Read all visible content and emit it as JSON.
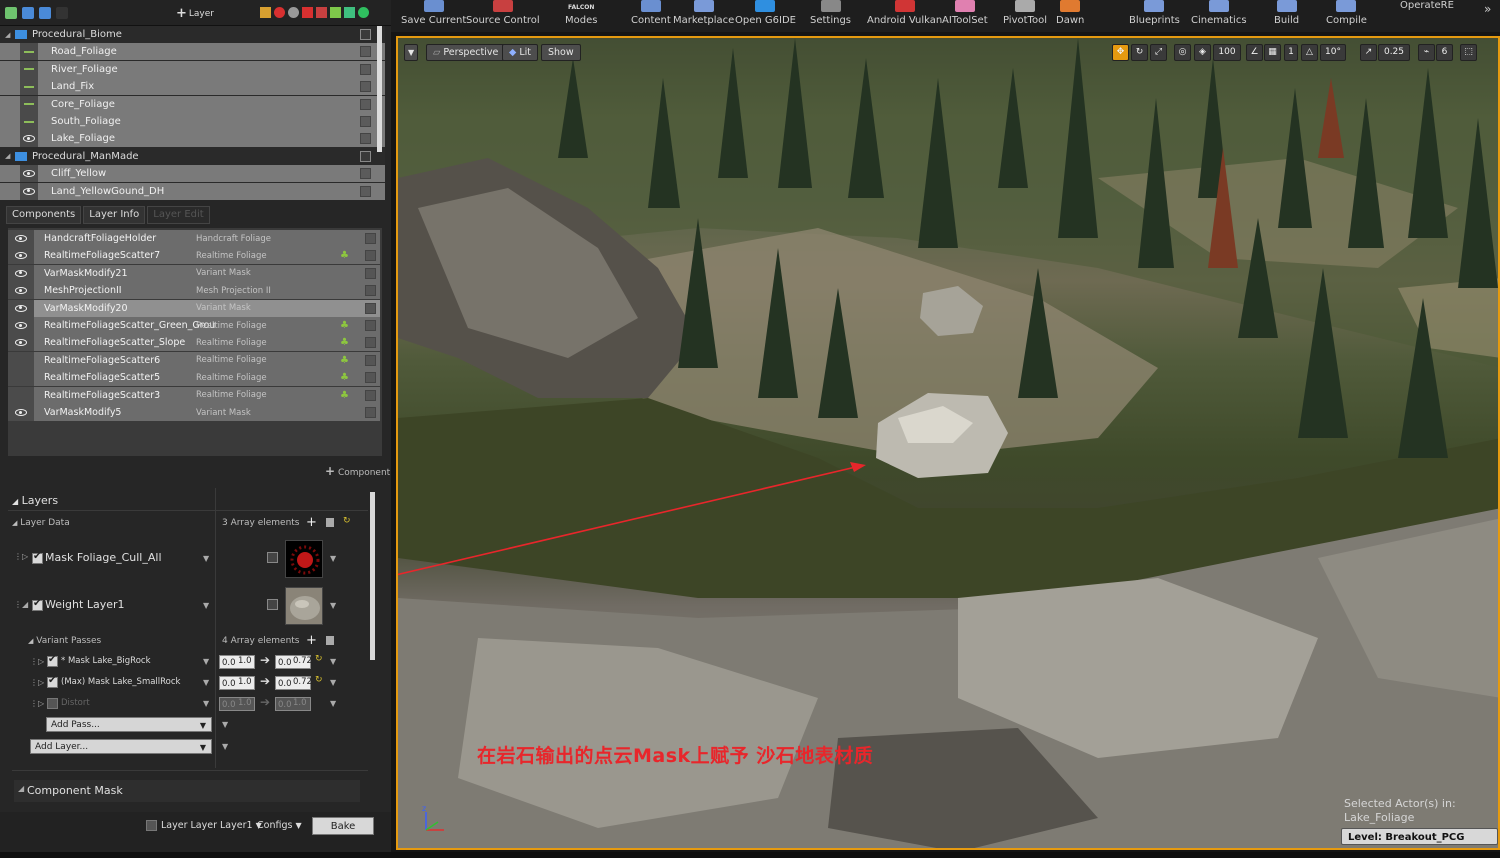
{
  "outliner": {
    "toolbar_layer_label": "Layer",
    "rows": [
      {
        "label": "Procedural_Biome",
        "type": "folder"
      },
      {
        "label": "Road_Foliage",
        "type": "child",
        "visible": false
      },
      {
        "label": "River_Foliage",
        "type": "child",
        "visible": false
      },
      {
        "label": "Land_Fix",
        "type": "child",
        "visible": false
      },
      {
        "label": "Core_Foliage",
        "type": "child",
        "visible": false
      },
      {
        "label": "South_Foliage",
        "type": "child",
        "visible": false
      },
      {
        "label": "Lake_Foliage",
        "type": "child",
        "visible": true
      },
      {
        "label": "Procedural_ManMade",
        "type": "folder"
      },
      {
        "label": "Cliff_Yellow",
        "type": "child",
        "visible": true
      },
      {
        "label": "Land_YellowGound_DH",
        "type": "child",
        "visible": true
      }
    ]
  },
  "tabs": [
    "Components",
    "Layer Info",
    "Layer Edit"
  ],
  "components": [
    {
      "name": "HandcraftFoliageHolder",
      "type": "Handcraft Foliage"
    },
    {
      "name": "RealtimeFoliageScatter7",
      "type": "Realtime Foliage"
    },
    {
      "name": "VarMaskModify21",
      "type": "Variant Mask"
    },
    {
      "name": "MeshProjectionII",
      "type": "Mesh Projection II"
    },
    {
      "name": "VarMaskModify20",
      "type": "Variant Mask"
    },
    {
      "name": "RealtimeFoliageScatter_Green_Grou",
      "type": "Realtime Foliage"
    },
    {
      "name": "RealtimeFoliageScatter_Slope",
      "type": "Realtime Foliage"
    },
    {
      "name": "RealtimeFoliageScatter6",
      "type": "Realtime Foliage"
    },
    {
      "name": "RealtimeFoliageScatter5",
      "type": "Realtime Foliage"
    },
    {
      "name": "RealtimeFoliageScatter3",
      "type": "Realtime Foliage"
    },
    {
      "name": "VarMaskModify5",
      "type": "Variant Mask"
    }
  ],
  "add_component_label": "Component",
  "layers": {
    "title": "Layers",
    "layer_data_label": "Layer Data",
    "layer_data_count": "3 Array elements",
    "mask_layer": "Mask Foliage_Cull_All",
    "weight_layer": "Weight Layer1",
    "variant_passes_label": "Variant Passes",
    "variant_passes_count": "4 Array elements",
    "passes": [
      {
        "label": "* Mask Lake_BigRock",
        "a": "0.0",
        "b": "1.0",
        "c": "0.0",
        "d": "0.72"
      },
      {
        "label": "(Max) Mask Lake_SmallRock",
        "a": "0.0",
        "b": "1.0",
        "c": "0.0",
        "d": "0.72"
      },
      {
        "label": "Distort",
        "a": "0.0",
        "b": "1.0",
        "c": "0.0",
        "d": "1.0"
      }
    ],
    "add_pass": "Add Pass...",
    "add_layer": "Add Layer...",
    "component_mask": "Component Mask"
  },
  "bottom": {
    "layer_label": "Layer Layer Layer1",
    "configs": "Configs",
    "bake": "Bake"
  },
  "toolbar": [
    {
      "label": "Save Current",
      "color": "#6a8fd0"
    },
    {
      "label": "Source Control",
      "color": "#c84040"
    },
    {
      "label": "Modes",
      "sub": "FALCON",
      "color": "#999999"
    },
    {
      "label": "Content",
      "color": "#6a8fd0"
    },
    {
      "label": "Marketplace",
      "color": "#7a9ad8"
    },
    {
      "label": "Open G6IDE",
      "color": "#2f8fe0"
    },
    {
      "label": "Settings",
      "color": "#888888"
    },
    {
      "label": "Android Vulkan",
      "color": "#d03535"
    },
    {
      "label": "AIToolSet",
      "color": "#e080b0"
    },
    {
      "label": "PivotTool",
      "color": "#aaaaaa"
    },
    {
      "label": "Dawn",
      "color": "#e07a30"
    },
    {
      "label": "Blueprints",
      "color": "#7a9ad8"
    },
    {
      "label": "Cinematics",
      "color": "#7a9ad8"
    },
    {
      "label": "Build",
      "color": "#7a9ad8"
    },
    {
      "label": "Compile",
      "color": "#7a9ad8"
    },
    {
      "label": "OperateRE",
      "color": "#1e1e1e"
    }
  ],
  "viewport": {
    "perspective": "Perspective",
    "lit": "Lit",
    "show": "Show",
    "grid_snap": "100",
    "rotate_snap_a": "1",
    "rotate_snap": "10°",
    "scale_snap": "0.25",
    "camera_speed": "6",
    "caption": "在岩石输出的点云Mask上赋予 沙石地表材质",
    "selected_actor": "Selected Actor(s) in:",
    "selected_folder": "Lake_Foliage",
    "level": "Level:  Breakout_PCG (Persistent)"
  }
}
